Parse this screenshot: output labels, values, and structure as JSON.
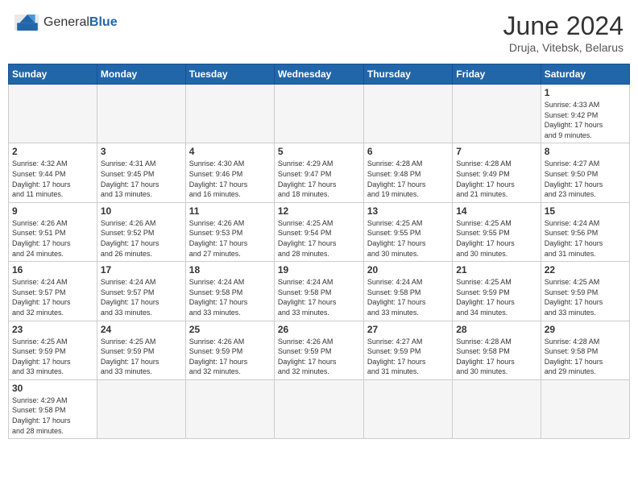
{
  "header": {
    "logo_general": "General",
    "logo_blue": "Blue",
    "title": "June 2024",
    "location": "Druja, Vitebsk, Belarus"
  },
  "weekdays": [
    "Sunday",
    "Monday",
    "Tuesday",
    "Wednesday",
    "Thursday",
    "Friday",
    "Saturday"
  ],
  "days": {
    "d1": {
      "num": "1",
      "info": "Sunrise: 4:33 AM\nSunset: 9:42 PM\nDaylight: 17 hours\nand 9 minutes."
    },
    "d2": {
      "num": "2",
      "info": "Sunrise: 4:32 AM\nSunset: 9:44 PM\nDaylight: 17 hours\nand 11 minutes."
    },
    "d3": {
      "num": "3",
      "info": "Sunrise: 4:31 AM\nSunset: 9:45 PM\nDaylight: 17 hours\nand 13 minutes."
    },
    "d4": {
      "num": "4",
      "info": "Sunrise: 4:30 AM\nSunset: 9:46 PM\nDaylight: 17 hours\nand 16 minutes."
    },
    "d5": {
      "num": "5",
      "info": "Sunrise: 4:29 AM\nSunset: 9:47 PM\nDaylight: 17 hours\nand 18 minutes."
    },
    "d6": {
      "num": "6",
      "info": "Sunrise: 4:28 AM\nSunset: 9:48 PM\nDaylight: 17 hours\nand 19 minutes."
    },
    "d7": {
      "num": "7",
      "info": "Sunrise: 4:28 AM\nSunset: 9:49 PM\nDaylight: 17 hours\nand 21 minutes."
    },
    "d8": {
      "num": "8",
      "info": "Sunrise: 4:27 AM\nSunset: 9:50 PM\nDaylight: 17 hours\nand 23 minutes."
    },
    "d9": {
      "num": "9",
      "info": "Sunrise: 4:26 AM\nSunset: 9:51 PM\nDaylight: 17 hours\nand 24 minutes."
    },
    "d10": {
      "num": "10",
      "info": "Sunrise: 4:26 AM\nSunset: 9:52 PM\nDaylight: 17 hours\nand 26 minutes."
    },
    "d11": {
      "num": "11",
      "info": "Sunrise: 4:26 AM\nSunset: 9:53 PM\nDaylight: 17 hours\nand 27 minutes."
    },
    "d12": {
      "num": "12",
      "info": "Sunrise: 4:25 AM\nSunset: 9:54 PM\nDaylight: 17 hours\nand 28 minutes."
    },
    "d13": {
      "num": "13",
      "info": "Sunrise: 4:25 AM\nSunset: 9:55 PM\nDaylight: 17 hours\nand 30 minutes."
    },
    "d14": {
      "num": "14",
      "info": "Sunrise: 4:25 AM\nSunset: 9:55 PM\nDaylight: 17 hours\nand 30 minutes."
    },
    "d15": {
      "num": "15",
      "info": "Sunrise: 4:24 AM\nSunset: 9:56 PM\nDaylight: 17 hours\nand 31 minutes."
    },
    "d16": {
      "num": "16",
      "info": "Sunrise: 4:24 AM\nSunset: 9:57 PM\nDaylight: 17 hours\nand 32 minutes."
    },
    "d17": {
      "num": "17",
      "info": "Sunrise: 4:24 AM\nSunset: 9:57 PM\nDaylight: 17 hours\nand 33 minutes."
    },
    "d18": {
      "num": "18",
      "info": "Sunrise: 4:24 AM\nSunset: 9:58 PM\nDaylight: 17 hours\nand 33 minutes."
    },
    "d19": {
      "num": "19",
      "info": "Sunrise: 4:24 AM\nSunset: 9:58 PM\nDaylight: 17 hours\nand 33 minutes."
    },
    "d20": {
      "num": "20",
      "info": "Sunrise: 4:24 AM\nSunset: 9:58 PM\nDaylight: 17 hours\nand 33 minutes."
    },
    "d21": {
      "num": "21",
      "info": "Sunrise: 4:25 AM\nSunset: 9:59 PM\nDaylight: 17 hours\nand 34 minutes."
    },
    "d22": {
      "num": "22",
      "info": "Sunrise: 4:25 AM\nSunset: 9:59 PM\nDaylight: 17 hours\nand 33 minutes."
    },
    "d23": {
      "num": "23",
      "info": "Sunrise: 4:25 AM\nSunset: 9:59 PM\nDaylight: 17 hours\nand 33 minutes."
    },
    "d24": {
      "num": "24",
      "info": "Sunrise: 4:25 AM\nSunset: 9:59 PM\nDaylight: 17 hours\nand 33 minutes."
    },
    "d25": {
      "num": "25",
      "info": "Sunrise: 4:26 AM\nSunset: 9:59 PM\nDaylight: 17 hours\nand 32 minutes."
    },
    "d26": {
      "num": "26",
      "info": "Sunrise: 4:26 AM\nSunset: 9:59 PM\nDaylight: 17 hours\nand 32 minutes."
    },
    "d27": {
      "num": "27",
      "info": "Sunrise: 4:27 AM\nSunset: 9:59 PM\nDaylight: 17 hours\nand 31 minutes."
    },
    "d28": {
      "num": "28",
      "info": "Sunrise: 4:28 AM\nSunset: 9:58 PM\nDaylight: 17 hours\nand 30 minutes."
    },
    "d29": {
      "num": "29",
      "info": "Sunrise: 4:28 AM\nSunset: 9:58 PM\nDaylight: 17 hours\nand 29 minutes."
    },
    "d30": {
      "num": "30",
      "info": "Sunrise: 4:29 AM\nSunset: 9:58 PM\nDaylight: 17 hours\nand 28 minutes."
    }
  }
}
